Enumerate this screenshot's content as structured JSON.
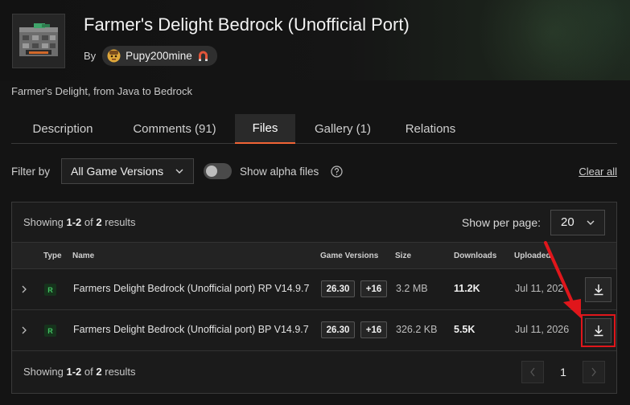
{
  "project": {
    "title": "Farmer's Delight Bedrock (Unofficial Port)",
    "by_label": "By",
    "author": "Pupy200mine",
    "summary": "Farmer's Delight, from Java to Bedrock"
  },
  "tabs": [
    {
      "label": "Description",
      "active": false
    },
    {
      "label": "Comments (91)",
      "active": false
    },
    {
      "label": "Files",
      "active": true
    },
    {
      "label": "Gallery (1)",
      "active": false
    },
    {
      "label": "Relations",
      "active": false
    }
  ],
  "filters": {
    "filter_by_label": "Filter by",
    "game_version_selected": "All Game Versions",
    "show_alpha_label": "Show alpha files",
    "show_alpha_on": false,
    "clear_all_label": "Clear all"
  },
  "results": {
    "showing_prefix": "Showing",
    "range": "1-2",
    "of_label": "of",
    "total": "2",
    "results_label": "results",
    "per_page_label": "Show per page:",
    "per_page_value": "20",
    "current_page": "1"
  },
  "table": {
    "headers": {
      "type": "Type",
      "name": "Name",
      "game_versions": "Game Versions",
      "size": "Size",
      "downloads": "Downloads",
      "uploaded": "Uploaded"
    },
    "rows": [
      {
        "type": "R",
        "name": "Farmers Delight Bedrock (Unofficial port) RP V14.9.7",
        "version": "26.30",
        "more_versions": "+16",
        "size": "3.2 MB",
        "downloads": "11.2K",
        "uploaded": "Jul 11, 2026"
      },
      {
        "type": "R",
        "name": "Farmers Delight Bedrock (Unofficial port) BP V14.9.7",
        "version": "26.30",
        "more_versions": "+16",
        "size": "326.2 KB",
        "downloads": "5.5K",
        "uploaded": "Jul 11, 2026"
      }
    ]
  },
  "colors": {
    "accent": "#f16436",
    "type_badge": "#43c162",
    "annotation": "#e0161b"
  }
}
